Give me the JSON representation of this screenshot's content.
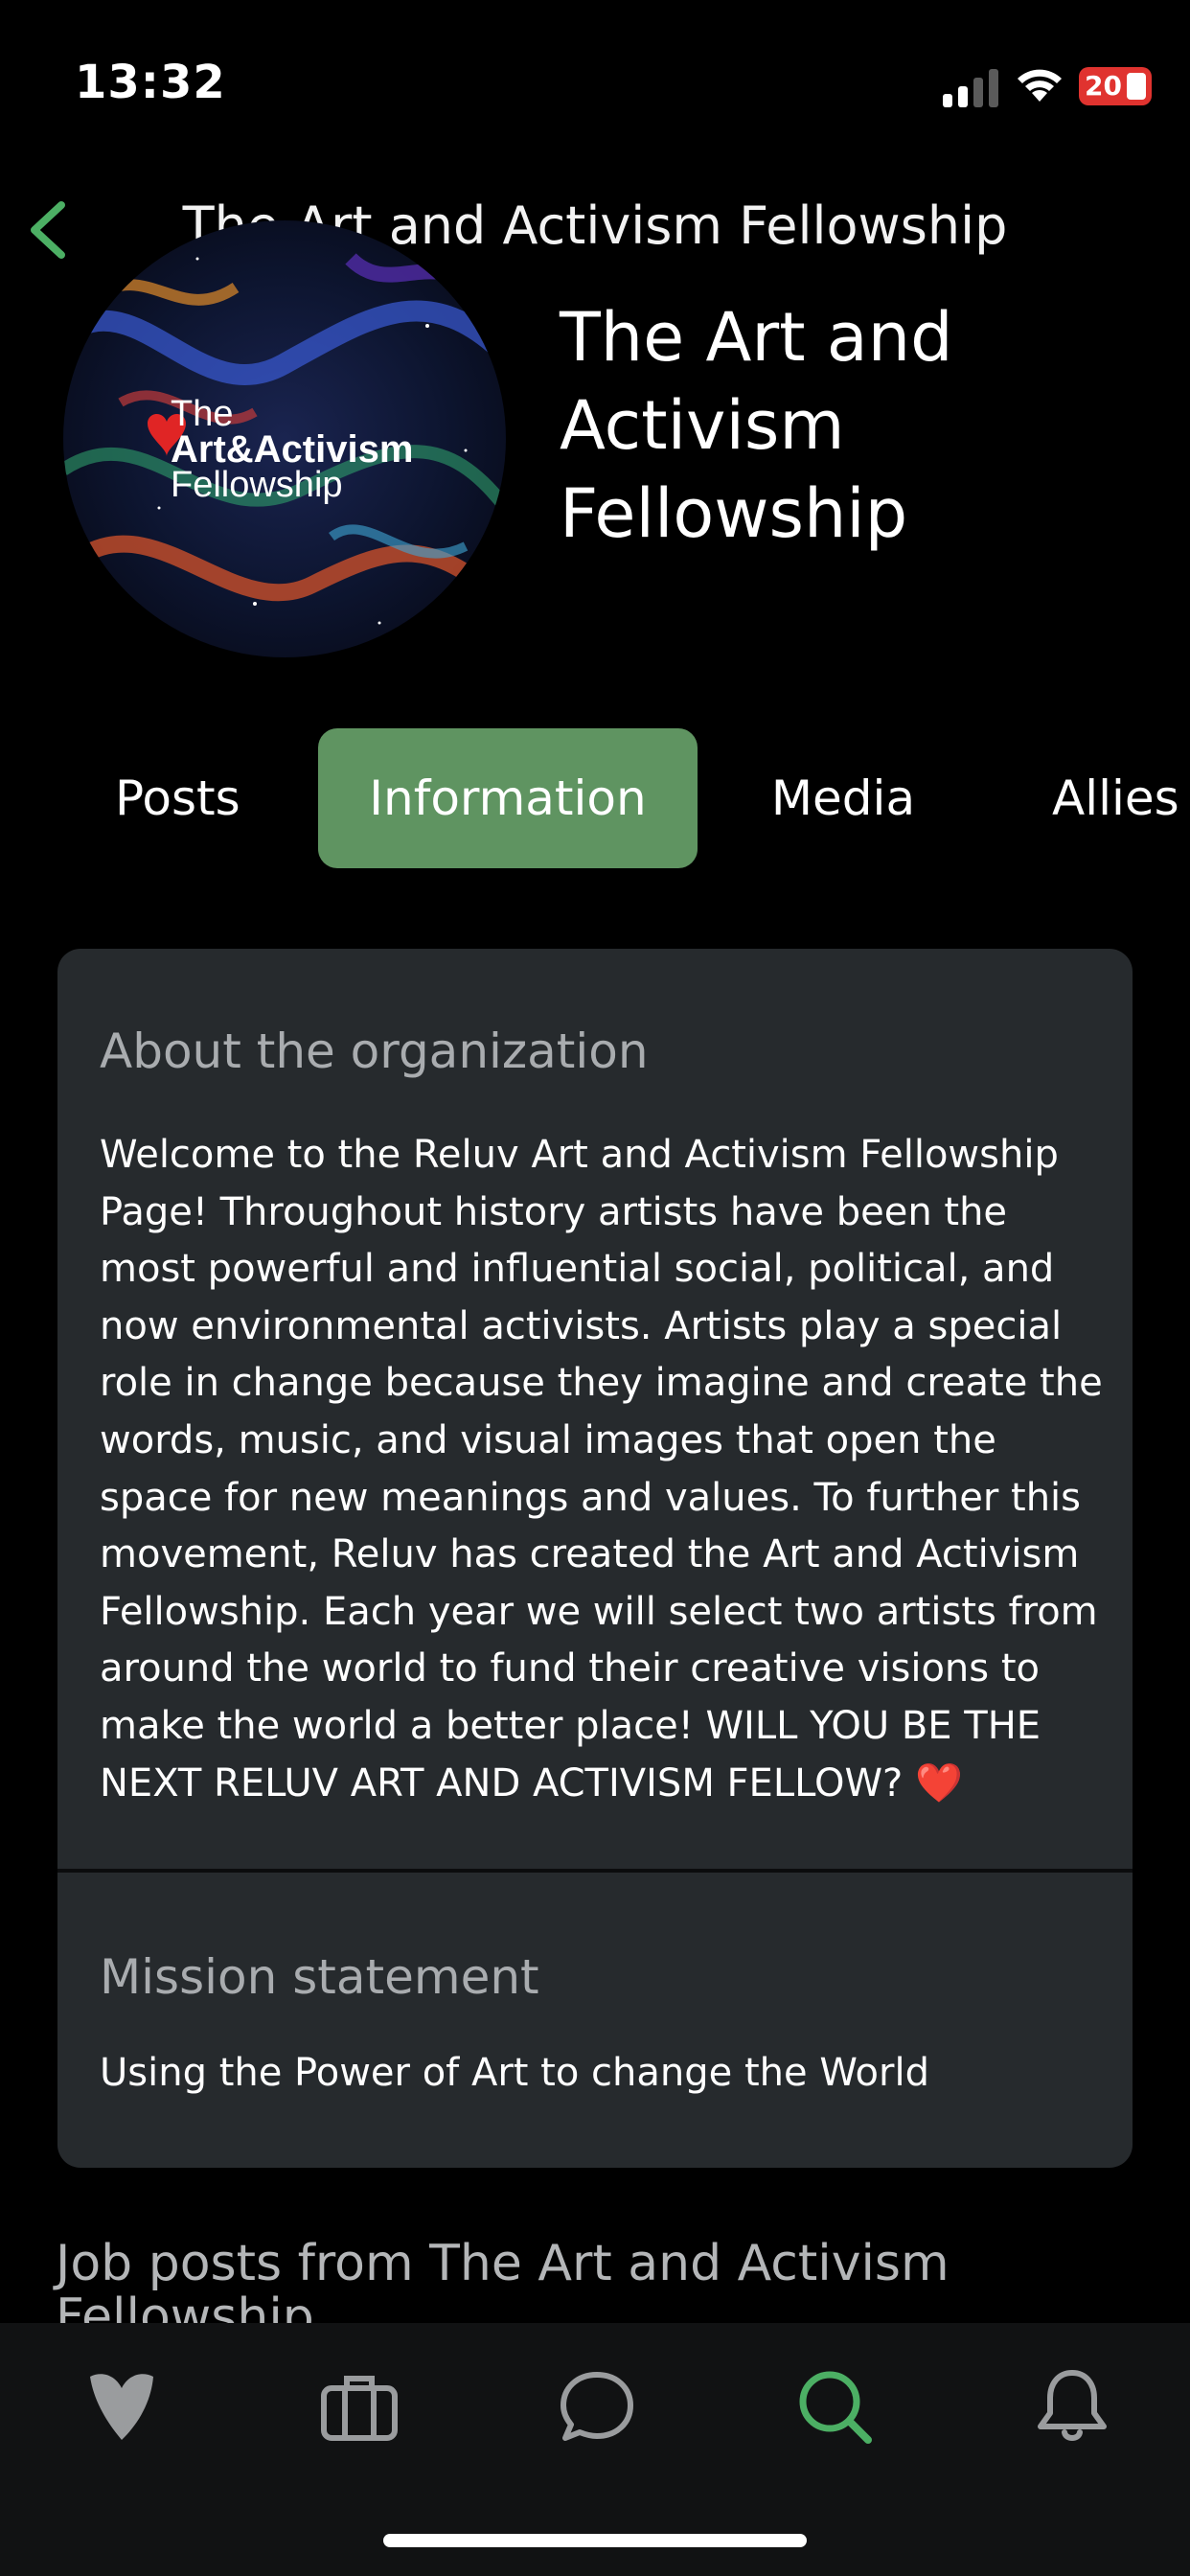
{
  "status_bar": {
    "time": "13:32",
    "battery": "20"
  },
  "header": {
    "title": "The Art and Activism Fellowship"
  },
  "profile": {
    "name": "The Art and Activism Fellowship",
    "logo_text": {
      "line1": "The",
      "line2": "Art&Activism",
      "line3": "Fellowship"
    }
  },
  "tabs": [
    {
      "label": "Posts",
      "active": false
    },
    {
      "label": "Information",
      "active": true
    },
    {
      "label": "Media",
      "active": false
    },
    {
      "label": "Allies",
      "active": false
    }
  ],
  "info": {
    "about_title": "About the organization",
    "about_text": "Welcome to the Reluv Art and Activism Fellowship Page! Throughout history artists have been the most powerful and influential social, political, and now environmental activists.  Artists play a special role in change because they imagine and create the words, music, and visual images that open the space for new meanings and values.  To further this movement, Reluv has created the Art and Activism Fellowship.  Each year we will select two artists from around the world to fund their creative visions to make the world a better place! WILL YOU BE THE NEXT RELUV ART AND ACTIVISM FELLOW? ❤️",
    "mission_title": "Mission statement",
    "mission_text": "Using the Power of Art to change the World"
  },
  "job_posts": {
    "heading": "Job posts from The Art and Activism Fellowship"
  },
  "bottom_nav": [
    {
      "icon": "heart-icon",
      "active": false
    },
    {
      "icon": "briefcase-icon",
      "active": false
    },
    {
      "icon": "chat-icon",
      "active": false
    },
    {
      "icon": "search-icon",
      "active": true
    },
    {
      "icon": "bell-icon",
      "active": false
    }
  ],
  "colors": {
    "accent_green": "#5f9461",
    "icon_active": "#4caf64",
    "card_bg": "#262a2d",
    "nav_bg": "#111213",
    "battery_red": "#e0332f"
  }
}
